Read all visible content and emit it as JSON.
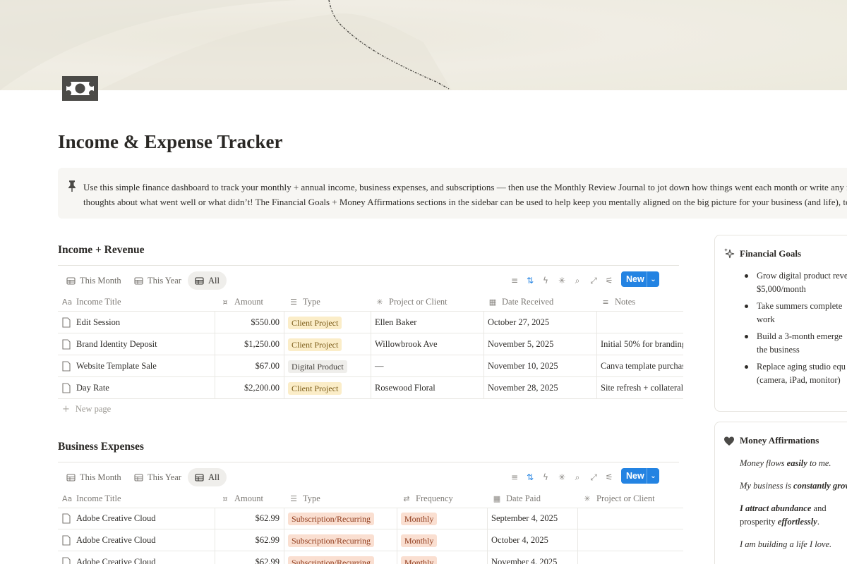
{
  "page": {
    "title": "Income & Expense Tracker",
    "callout_line1": "Use this simple finance dashboard to track your monthly + annual income, business expenses, and subscriptions — then use the Monthly Review Journal to jot down how things went each month or write any no",
    "callout_line2": "thoughts about what went well or what didn’t! The Financial Goals + Money Affirmations sections in the sidebar can be used to help keep you mentally aligned on the big picture for your business (and life), too"
  },
  "views": {
    "this_month": "This Month",
    "this_year": "This Year",
    "all": "All",
    "new_button": "New"
  },
  "income": {
    "title": "Income + Revenue",
    "columns": {
      "title": "Income Title",
      "amount": "Amount",
      "type": "Type",
      "project": "Project or Client",
      "date": "Date Received",
      "notes": "Notes"
    },
    "rows": [
      {
        "title": "Edit Session",
        "amount": "$550.00",
        "type": "Client Project",
        "project": "Ellen Baker",
        "date": "October 27, 2025",
        "notes": ""
      },
      {
        "title": "Brand Identity Deposit",
        "amount": "$1,250.00",
        "type": "Client Project",
        "project": "Willowbrook Ave",
        "date": "November 5, 2025",
        "notes": "Initial 50% for branding"
      },
      {
        "title": "Website Template Sale",
        "amount": "$67.00",
        "type": "Digital Product",
        "project": "—",
        "date": "November 10, 2025",
        "notes": "Canva template purchas"
      },
      {
        "title": "Day Rate",
        "amount": "$2,200.00",
        "type": "Client Project",
        "project": "Rosewood Floral",
        "date": "November 28, 2025",
        "notes": "Site refresh + collateral u"
      }
    ],
    "new_page": "New page"
  },
  "expenses": {
    "title": "Business Expenses",
    "columns": {
      "title": "Income Title",
      "amount": "Amount",
      "type": "Type",
      "frequency": "Frequency",
      "date": "Date Paid",
      "project": "Project or Client"
    },
    "rows": [
      {
        "title": "Adobe Creative Cloud",
        "amount": "$62.99",
        "type": "Subscription/Recurring",
        "frequency": "Monthly",
        "date": "September 4, 2025"
      },
      {
        "title": "Adobe Creative Cloud",
        "amount": "$62.99",
        "type": "Subscription/Recurring",
        "frequency": "Monthly",
        "date": "October 4, 2025"
      },
      {
        "title": "Adobe Creative Cloud",
        "amount": "$62.99",
        "type": "Subscription/Recurring",
        "frequency": "Monthly",
        "date": "November 4, 2025"
      }
    ]
  },
  "sidebar": {
    "goals": {
      "title": "Financial Goals",
      "items": [
        {
          "line1": "Grow digital product reve",
          "line2": "$5,000/month"
        },
        {
          "line1": "Take summers complete",
          "line2": "work"
        },
        {
          "line1": "Build a 3-month emerge",
          "line2": "the business"
        },
        {
          "line1": "Replace aging studio equ",
          "line2": "(camera, iPad, monitor)"
        }
      ]
    },
    "affirmations": {
      "title": "Money Affirmations",
      "a1_pre": "Money flows ",
      "a1_bold": "easily",
      "a1_post": " to me.",
      "a2_pre": "My business is ",
      "a2_bold": "constantly grow",
      "a3_bold": "I attract abundance",
      "a3_post": " and",
      "a4_pre": "prosperity ",
      "a4_bold": "effortlessly",
      "a4_post": ".",
      "a5": "I am building a life I love."
    }
  },
  "colors": {
    "accent": "#2383e2",
    "tag_yellow": "#fbedc8",
    "tag_peach": "#fadfd1",
    "tag_gray": "#efeeeb"
  }
}
